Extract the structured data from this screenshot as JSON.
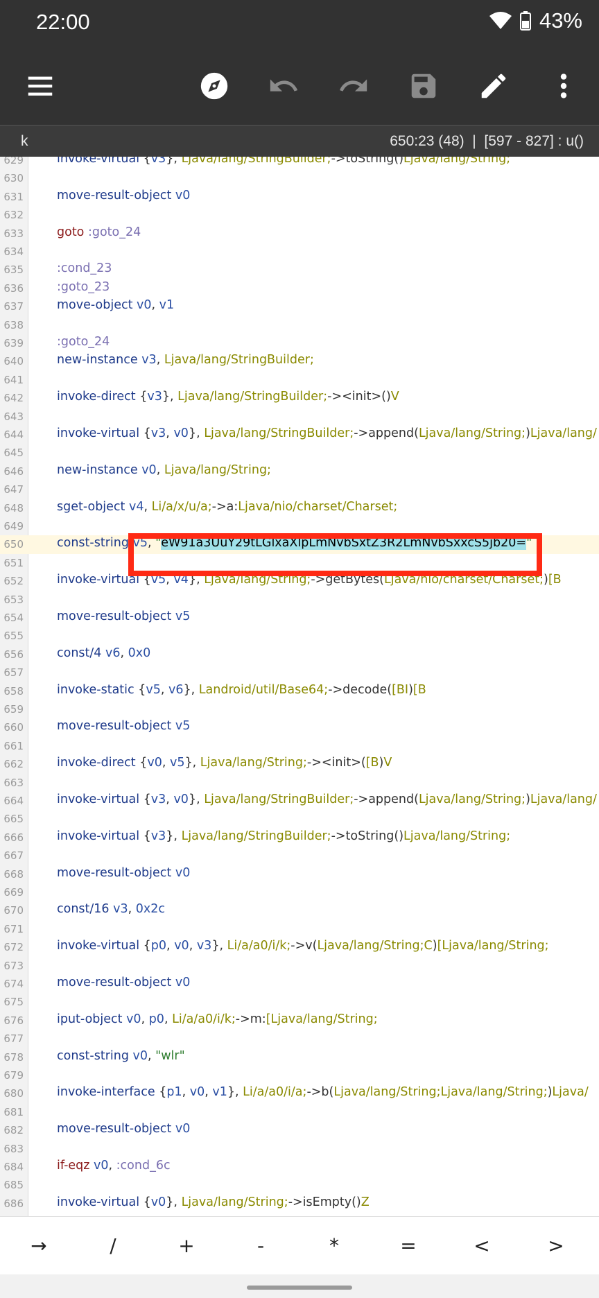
{
  "status": {
    "time": "22:00",
    "battery": "43%"
  },
  "toolbar": {
    "buttons": [
      "menu-icon",
      "compass-icon",
      "undo-icon",
      "redo-icon",
      "save-icon",
      "edit-icon",
      "more-vert-icon"
    ]
  },
  "info": {
    "left": "k",
    "right": "650:23 (48)  |  [597 - 827] : u()"
  },
  "editor": {
    "lines": [
      {
        "n": "629",
        "t": [
          [
            "kw",
            "invoke-virtual "
          ],
          [
            "pn",
            "{"
          ],
          [
            "reg",
            "v3"
          ],
          [
            "pn",
            "}, "
          ],
          [
            "typ",
            "Ljava/lang/StringBuilder;"
          ],
          [
            "pn",
            "->toString("
          ],
          [
            "pn",
            ")"
          ],
          [
            "typ",
            "Ljava/lang/String;"
          ]
        ]
      },
      {
        "n": "630",
        "t": []
      },
      {
        "n": "631",
        "t": [
          [
            "kw",
            "move-result-object "
          ],
          [
            "reg",
            "v0"
          ]
        ]
      },
      {
        "n": "632",
        "t": []
      },
      {
        "n": "633",
        "t": [
          [
            "kw2",
            "goto "
          ],
          [
            "lbl",
            ":goto_24"
          ]
        ]
      },
      {
        "n": "634",
        "t": []
      },
      {
        "n": "635",
        "t": [
          [
            "lbl",
            ":cond_23"
          ]
        ]
      },
      {
        "n": "636",
        "t": [
          [
            "lbl",
            ":goto_23"
          ]
        ]
      },
      {
        "n": "637",
        "t": [
          [
            "kw",
            "move-object "
          ],
          [
            "reg",
            "v0"
          ],
          [
            "pn",
            ", "
          ],
          [
            "reg",
            "v1"
          ]
        ]
      },
      {
        "n": "638",
        "t": []
      },
      {
        "n": "639",
        "t": [
          [
            "lbl",
            ":goto_24"
          ]
        ]
      },
      {
        "n": "640",
        "t": [
          [
            "kw",
            "new-instance "
          ],
          [
            "reg",
            "v3"
          ],
          [
            "pn",
            ", "
          ],
          [
            "typ",
            "Ljava/lang/StringBuilder;"
          ]
        ]
      },
      {
        "n": "641",
        "t": []
      },
      {
        "n": "642",
        "t": [
          [
            "kw",
            "invoke-direct "
          ],
          [
            "pn",
            "{"
          ],
          [
            "reg",
            "v3"
          ],
          [
            "pn",
            "}, "
          ],
          [
            "typ",
            "Ljava/lang/StringBuilder;"
          ],
          [
            "pn",
            "-><init>("
          ],
          [
            "pn",
            ")"
          ],
          [
            "typ",
            "V"
          ]
        ]
      },
      {
        "n": "643",
        "t": []
      },
      {
        "n": "644",
        "t": [
          [
            "kw",
            "invoke-virtual "
          ],
          [
            "pn",
            "{"
          ],
          [
            "reg",
            "v3"
          ],
          [
            "pn",
            ", "
          ],
          [
            "reg",
            "v0"
          ],
          [
            "pn",
            "}, "
          ],
          [
            "typ",
            "Ljava/lang/StringBuilder;"
          ],
          [
            "pn",
            "->append("
          ],
          [
            "typ",
            "Ljava/lang/String;"
          ],
          [
            "pn",
            ")"
          ],
          [
            "typ",
            "Ljava/lang/"
          ]
        ]
      },
      {
        "n": "645",
        "t": []
      },
      {
        "n": "646",
        "t": [
          [
            "kw",
            "new-instance "
          ],
          [
            "reg",
            "v0"
          ],
          [
            "pn",
            ", "
          ],
          [
            "typ",
            "Ljava/lang/String;"
          ]
        ]
      },
      {
        "n": "647",
        "t": []
      },
      {
        "n": "648",
        "t": [
          [
            "kw",
            "sget-object "
          ],
          [
            "reg",
            "v4"
          ],
          [
            "pn",
            ", "
          ],
          [
            "typ",
            "Li/a/x/u/a;"
          ],
          [
            "pn",
            "->a:"
          ],
          [
            "typ",
            "Ljava/nio/charset/Charset;"
          ]
        ]
      },
      {
        "n": "649",
        "t": []
      },
      {
        "n": "650",
        "cur": true,
        "t": [
          [
            "kw",
            "const-string "
          ],
          [
            "reg",
            "v5"
          ],
          [
            "pn",
            ", "
          ],
          [
            "str",
            "\""
          ],
          [
            "sel",
            "eW91a3UuY29tLGlxaXlpLmNvbSxtZ3R2LmNvbSxxcS5jb20="
          ],
          [
            "str",
            "\""
          ]
        ]
      },
      {
        "n": "651",
        "t": []
      },
      {
        "n": "652",
        "t": [
          [
            "kw",
            "invoke-virtual "
          ],
          [
            "pn",
            "{"
          ],
          [
            "reg",
            "v5"
          ],
          [
            "pn",
            ", "
          ],
          [
            "reg",
            "v4"
          ],
          [
            "pn",
            "}, "
          ],
          [
            "typ",
            "Ljava/lang/String;"
          ],
          [
            "pn",
            "->getBytes("
          ],
          [
            "typ",
            "Ljava/nio/charset/Charset;"
          ],
          [
            "pn",
            ")"
          ],
          [
            "typ",
            "[B"
          ]
        ]
      },
      {
        "n": "653",
        "t": []
      },
      {
        "n": "654",
        "t": [
          [
            "kw",
            "move-result-object "
          ],
          [
            "reg",
            "v5"
          ]
        ]
      },
      {
        "n": "655",
        "t": []
      },
      {
        "n": "656",
        "t": [
          [
            "kw",
            "const/4 "
          ],
          [
            "reg",
            "v6"
          ],
          [
            "pn",
            ", "
          ],
          [
            "num",
            "0x0"
          ]
        ]
      },
      {
        "n": "657",
        "t": []
      },
      {
        "n": "658",
        "t": [
          [
            "kw",
            "invoke-static "
          ],
          [
            "pn",
            "{"
          ],
          [
            "reg",
            "v5"
          ],
          [
            "pn",
            ", "
          ],
          [
            "reg",
            "v6"
          ],
          [
            "pn",
            "}, "
          ],
          [
            "typ",
            "Landroid/util/Base64;"
          ],
          [
            "pn",
            "->decode("
          ],
          [
            "typ",
            "[BI"
          ],
          [
            "pn",
            ")"
          ],
          [
            "typ",
            "[B"
          ]
        ]
      },
      {
        "n": "659",
        "t": []
      },
      {
        "n": "660",
        "t": [
          [
            "kw",
            "move-result-object "
          ],
          [
            "reg",
            "v5"
          ]
        ]
      },
      {
        "n": "661",
        "t": []
      },
      {
        "n": "662",
        "t": [
          [
            "kw",
            "invoke-direct "
          ],
          [
            "pn",
            "{"
          ],
          [
            "reg",
            "v0"
          ],
          [
            "pn",
            ", "
          ],
          [
            "reg",
            "v5"
          ],
          [
            "pn",
            "}, "
          ],
          [
            "typ",
            "Ljava/lang/String;"
          ],
          [
            "pn",
            "-><init>("
          ],
          [
            "typ",
            "[B"
          ],
          [
            "pn",
            ")"
          ],
          [
            "typ",
            "V"
          ]
        ]
      },
      {
        "n": "663",
        "t": []
      },
      {
        "n": "664",
        "t": [
          [
            "kw",
            "invoke-virtual "
          ],
          [
            "pn",
            "{"
          ],
          [
            "reg",
            "v3"
          ],
          [
            "pn",
            ", "
          ],
          [
            "reg",
            "v0"
          ],
          [
            "pn",
            "}, "
          ],
          [
            "typ",
            "Ljava/lang/StringBuilder;"
          ],
          [
            "pn",
            "->append("
          ],
          [
            "typ",
            "Ljava/lang/String;"
          ],
          [
            "pn",
            ")"
          ],
          [
            "typ",
            "Ljava/lang/"
          ]
        ]
      },
      {
        "n": "665",
        "t": []
      },
      {
        "n": "666",
        "t": [
          [
            "kw",
            "invoke-virtual "
          ],
          [
            "pn",
            "{"
          ],
          [
            "reg",
            "v3"
          ],
          [
            "pn",
            "}, "
          ],
          [
            "typ",
            "Ljava/lang/StringBuilder;"
          ],
          [
            "pn",
            "->toString("
          ],
          [
            "pn",
            ")"
          ],
          [
            "typ",
            "Ljava/lang/String;"
          ]
        ]
      },
      {
        "n": "667",
        "t": []
      },
      {
        "n": "668",
        "t": [
          [
            "kw",
            "move-result-object "
          ],
          [
            "reg",
            "v0"
          ]
        ]
      },
      {
        "n": "669",
        "t": []
      },
      {
        "n": "670",
        "t": [
          [
            "kw",
            "const/16 "
          ],
          [
            "reg",
            "v3"
          ],
          [
            "pn",
            ", "
          ],
          [
            "num",
            "0x2c"
          ]
        ]
      },
      {
        "n": "671",
        "t": []
      },
      {
        "n": "672",
        "t": [
          [
            "kw",
            "invoke-virtual "
          ],
          [
            "pn",
            "{"
          ],
          [
            "reg",
            "p0"
          ],
          [
            "pn",
            ", "
          ],
          [
            "reg",
            "v0"
          ],
          [
            "pn",
            ", "
          ],
          [
            "reg",
            "v3"
          ],
          [
            "pn",
            "}, "
          ],
          [
            "typ",
            "Li/a/a0/i/k;"
          ],
          [
            "pn",
            "->v("
          ],
          [
            "typ",
            "Ljava/lang/String;C"
          ],
          [
            "pn",
            ")"
          ],
          [
            "typ",
            "[Ljava/lang/String;"
          ]
        ]
      },
      {
        "n": "673",
        "t": []
      },
      {
        "n": "674",
        "t": [
          [
            "kw",
            "move-result-object "
          ],
          [
            "reg",
            "v0"
          ]
        ]
      },
      {
        "n": "675",
        "t": []
      },
      {
        "n": "676",
        "t": [
          [
            "kw",
            "iput-object "
          ],
          [
            "reg",
            "v0"
          ],
          [
            "pn",
            ", "
          ],
          [
            "reg",
            "p0"
          ],
          [
            "pn",
            ", "
          ],
          [
            "typ",
            "Li/a/a0/i/k;"
          ],
          [
            "pn",
            "->m:"
          ],
          [
            "typ",
            "[Ljava/lang/String;"
          ]
        ]
      },
      {
        "n": "677",
        "t": []
      },
      {
        "n": "678",
        "t": [
          [
            "kw",
            "const-string "
          ],
          [
            "reg",
            "v0"
          ],
          [
            "pn",
            ", "
          ],
          [
            "str",
            "\"wlr\""
          ]
        ]
      },
      {
        "n": "679",
        "t": []
      },
      {
        "n": "680",
        "t": [
          [
            "kw",
            "invoke-interface "
          ],
          [
            "pn",
            "{"
          ],
          [
            "reg",
            "p1"
          ],
          [
            "pn",
            ", "
          ],
          [
            "reg",
            "v0"
          ],
          [
            "pn",
            ", "
          ],
          [
            "reg",
            "v1"
          ],
          [
            "pn",
            "}, "
          ],
          [
            "typ",
            "Li/a/a0/i/a;"
          ],
          [
            "pn",
            "->b("
          ],
          [
            "typ",
            "Ljava/lang/String;Ljava/lang/String;"
          ],
          [
            "pn",
            ")"
          ],
          [
            "typ",
            "Ljava/"
          ]
        ]
      },
      {
        "n": "681",
        "t": []
      },
      {
        "n": "682",
        "t": [
          [
            "kw",
            "move-result-object "
          ],
          [
            "reg",
            "v0"
          ]
        ]
      },
      {
        "n": "683",
        "t": []
      },
      {
        "n": "684",
        "t": [
          [
            "kw2",
            "if-eqz "
          ],
          [
            "reg",
            "v0"
          ],
          [
            "pn",
            ", "
          ],
          [
            "lbl",
            ":cond_6c"
          ]
        ]
      },
      {
        "n": "685",
        "t": []
      },
      {
        "n": "686",
        "t": [
          [
            "kw",
            "invoke-virtual "
          ],
          [
            "pn",
            "{"
          ],
          [
            "reg",
            "v0"
          ],
          [
            "pn",
            "}, "
          ],
          [
            "typ",
            "Ljava/lang/String;"
          ],
          [
            "pn",
            "->isEmpty("
          ],
          [
            "pn",
            ")"
          ],
          [
            "typ",
            "Z"
          ]
        ]
      }
    ]
  },
  "keys": [
    "→",
    "/",
    "+",
    "-",
    "*",
    "=",
    "<",
    ">"
  ]
}
